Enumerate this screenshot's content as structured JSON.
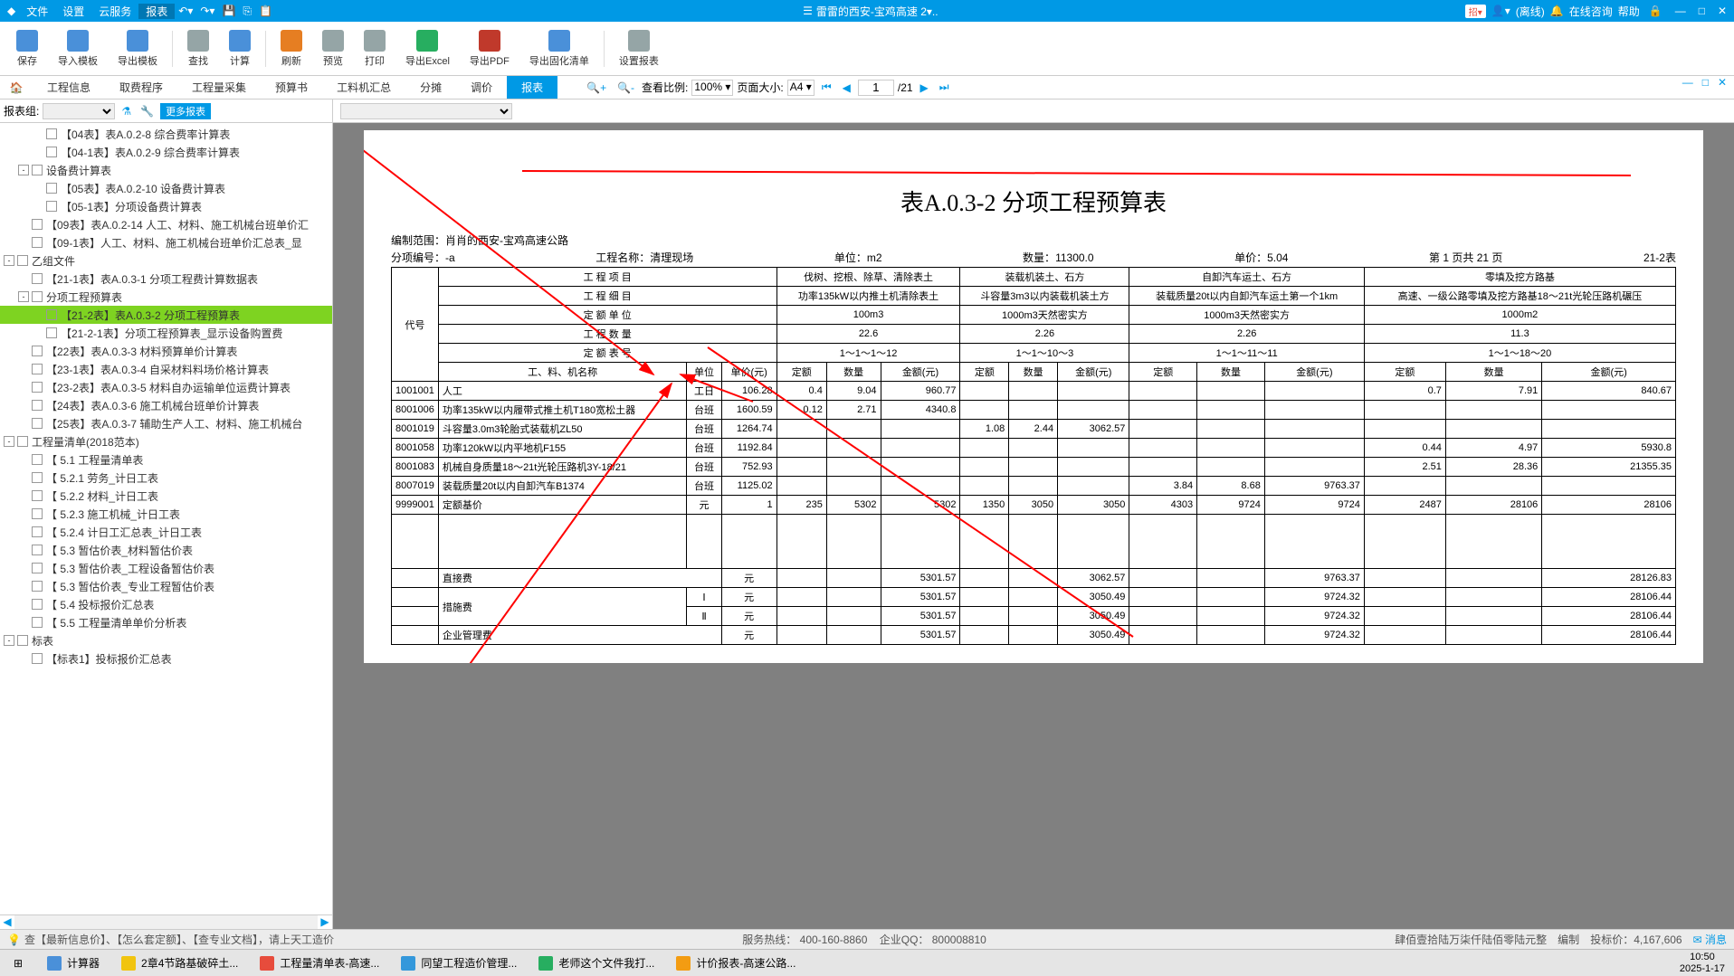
{
  "titleBar": {
    "menus": [
      "文件",
      "设置",
      "云服务",
      "报表"
    ],
    "docTitle": "雷雷的西安-宝鸡高速 2▾..",
    "badge": "招▾",
    "status": "(离线)",
    "consult": "在线咨询",
    "help": "帮助"
  },
  "ribbon": {
    "items": [
      "保存",
      "导入模板",
      "导出模板",
      "查找",
      "计算",
      "刷新",
      "预览",
      "打印",
      "导出Excel",
      "导出PDF",
      "导出固化清单",
      "设置报表"
    ]
  },
  "secTabs": {
    "tabs": [
      "工程信息",
      "取费程序",
      "工程量采集",
      "预算书",
      "工料机汇总",
      "分摊",
      "调价",
      "报表"
    ],
    "active": 7,
    "zoomLabel": "查看比例:",
    "zoomVal": "100% ▾",
    "pageSizeLabel": "页面大小:",
    "pageSizeVal": "A4 ▾",
    "pageInput": "1",
    "pageTotal": "/21"
  },
  "sidebar": {
    "groupLabel": "报表组:",
    "moreBtn": "更多报表",
    "tree": [
      {
        "lvl": 2,
        "exp": "",
        "label": "【04表】表A.0.2-8 综合费率计算表"
      },
      {
        "lvl": 2,
        "exp": "",
        "label": "【04-1表】表A.0.2-9 综合费率计算表"
      },
      {
        "lvl": 1,
        "exp": "-",
        "label": "设备费计算表"
      },
      {
        "lvl": 2,
        "exp": "",
        "label": "【05表】表A.0.2-10 设备费计算表"
      },
      {
        "lvl": 2,
        "exp": "",
        "label": "【05-1表】分项设备费计算表"
      },
      {
        "lvl": 1,
        "exp": "",
        "label": "【09表】表A.0.2-14 人工、材料、施工机械台班单价汇"
      },
      {
        "lvl": 1,
        "exp": "",
        "label": "【09-1表】人工、材料、施工机械台班单价汇总表_显"
      },
      {
        "lvl": 0,
        "exp": "-",
        "label": "乙组文件"
      },
      {
        "lvl": 1,
        "exp": "",
        "label": "【21-1表】表A.0.3-1 分项工程费计算数据表"
      },
      {
        "lvl": 1,
        "exp": "-",
        "label": "分项工程预算表"
      },
      {
        "lvl": 2,
        "exp": "",
        "label": "【21-2表】表A.0.3-2 分项工程预算表",
        "selected": true
      },
      {
        "lvl": 2,
        "exp": "",
        "label": "【21-2-1表】分项工程预算表_显示设备购置费"
      },
      {
        "lvl": 1,
        "exp": "",
        "label": "【22表】表A.0.3-3 材料预算单价计算表"
      },
      {
        "lvl": 1,
        "exp": "",
        "label": "【23-1表】表A.0.3-4 自采材料料场价格计算表"
      },
      {
        "lvl": 1,
        "exp": "",
        "label": "【23-2表】表A.0.3-5 材料自办运输单位运费计算表"
      },
      {
        "lvl": 1,
        "exp": "",
        "label": "【24表】表A.0.3-6 施工机械台班单价计算表"
      },
      {
        "lvl": 1,
        "exp": "",
        "label": "【25表】表A.0.3-7 辅助生产人工、材料、施工机械台"
      },
      {
        "lvl": 0,
        "exp": "-",
        "label": "工程量清单(2018范本)"
      },
      {
        "lvl": 1,
        "exp": "",
        "label": "【 5.1 工程量清单表"
      },
      {
        "lvl": 1,
        "exp": "",
        "label": "【 5.2.1 劳务_计日工表"
      },
      {
        "lvl": 1,
        "exp": "",
        "label": "【 5.2.2 材料_计日工表"
      },
      {
        "lvl": 1,
        "exp": "",
        "label": "【 5.2.3 施工机械_计日工表"
      },
      {
        "lvl": 1,
        "exp": "",
        "label": "【 5.2.4 计日工汇总表_计日工表"
      },
      {
        "lvl": 1,
        "exp": "",
        "label": "【 5.3 暂估价表_材料暂估价表"
      },
      {
        "lvl": 1,
        "exp": "",
        "label": "【 5.3 暂估价表_工程设备暂估价表"
      },
      {
        "lvl": 1,
        "exp": "",
        "label": "【 5.3 暂估价表_专业工程暂估价表"
      },
      {
        "lvl": 1,
        "exp": "",
        "label": "【 5.4 投标报价汇总表"
      },
      {
        "lvl": 1,
        "exp": "",
        "label": "【 5.5 工程量清单单价分析表"
      },
      {
        "lvl": 0,
        "exp": "-",
        "label": "标表"
      },
      {
        "lvl": 1,
        "exp": "",
        "label": "【标表1】投标报价汇总表"
      }
    ]
  },
  "report": {
    "title": "表A.0.3-2  分项工程预算表",
    "meta": {
      "scopeLabel": "编制范围：",
      "scope": "肖肖的西安-宝鸡高速公路",
      "codeLabel": "分项编号：",
      "code": "-a",
      "nameLabel": "工程名称：",
      "name": "清理现场",
      "unitLabel": "单位：",
      "unit": "m2",
      "qtyLabel": "数量：",
      "qty": "11300.0",
      "priceLabel": "单价：",
      "price": "5.04",
      "pageLabel": "第 1 页共 21 页",
      "tableNo": "21-2表"
    },
    "headers": {
      "daihao": "代号",
      "gcxm": "工 程 项 目",
      "gcxd": "工 程 细 目",
      "dedw": "定 额 单 位",
      "gcsl": "工 程 数 量",
      "debh": "定 额 表 号",
      "gljmc": "工、料、机名称",
      "dw": "单位",
      "dj": "单价(元)",
      "de": "定额",
      "sl": "数量",
      "je": "金额(元)"
    },
    "projItems": [
      "伐树、挖根、除草、清除表土",
      "装载机装土、石方",
      "自卸汽车运土、石方",
      "零填及挖方路基"
    ],
    "details": [
      "功率135kW以内推土机清除表土",
      "斗容量3m3以内装载机装土方",
      "装载质量20t以内自卸汽车运土第一个1km",
      "高速、一级公路零填及挖方路基18～21t光轮压路机碾压"
    ],
    "units": [
      "100m3",
      "1000m3天然密实方",
      "1000m3天然密实方",
      "1000m2"
    ],
    "qtys": [
      "22.6",
      "2.26",
      "2.26",
      "11.3"
    ],
    "tabNos": [
      "1～1～1～12",
      "1～1～10～3",
      "1～1～11～11",
      "1～1～18～20"
    ],
    "rows": [
      {
        "code": "1001001",
        "name": "人工",
        "unit": "工日",
        "price": "106.28",
        "c": [
          [
            "0.4",
            "9.04",
            "960.77"
          ],
          [
            "",
            "",
            ""
          ],
          [
            "",
            "",
            ""
          ],
          [
            "0.7",
            "7.91",
            "840.67"
          ]
        ]
      },
      {
        "code": "8001006",
        "name": "功率135kW以内履带式推土机T180宽松土器",
        "unit": "台班",
        "price": "1600.59",
        "c": [
          [
            "0.12",
            "2.71",
            "4340.8"
          ],
          [
            "",
            "",
            ""
          ],
          [
            "",
            "",
            ""
          ],
          [
            "",
            "",
            ""
          ]
        ]
      },
      {
        "code": "8001019",
        "name": "斗容量3.0m3轮胎式装载机ZL50",
        "unit": "台班",
        "price": "1264.74",
        "c": [
          [
            "",
            "",
            ""
          ],
          [
            "1.08",
            "2.44",
            "3062.57"
          ],
          [
            "",
            "",
            ""
          ],
          [
            "",
            "",
            ""
          ]
        ]
      },
      {
        "code": "8001058",
        "name": "功率120kW以内平地机F155",
        "unit": "台班",
        "price": "1192.84",
        "c": [
          [
            "",
            "",
            ""
          ],
          [
            "",
            "",
            ""
          ],
          [
            "",
            "",
            ""
          ],
          [
            "0.44",
            "4.97",
            "5930.8"
          ]
        ]
      },
      {
        "code": "8001083",
        "name": "机械自身质量18～21t光轮压路机3Y-18/21",
        "unit": "台班",
        "price": "752.93",
        "c": [
          [
            "",
            "",
            ""
          ],
          [
            "",
            "",
            ""
          ],
          [
            "",
            "",
            ""
          ],
          [
            "2.51",
            "28.36",
            "21355.35"
          ]
        ]
      },
      {
        "code": "8007019",
        "name": "装载质量20t以内自卸汽车B1374",
        "unit": "台班",
        "price": "1125.02",
        "c": [
          [
            "",
            "",
            ""
          ],
          [
            "",
            "",
            ""
          ],
          [
            "3.84",
            "8.68",
            "9763.37"
          ],
          [
            "",
            "",
            ""
          ]
        ]
      },
      {
        "code": "9999001",
        "name": "定额基价",
        "unit": "元",
        "price": "1",
        "c": [
          [
            "235",
            "5302",
            "5302"
          ],
          [
            "1350",
            "3050",
            "3050"
          ],
          [
            "4303",
            "9724",
            "9724"
          ],
          [
            "2487",
            "28106",
            "28106"
          ]
        ]
      }
    ],
    "subtotals": {
      "direct": {
        "label": "直接费",
        "unit": "元",
        "v": [
          "5301.57",
          "",
          "3062.57",
          "",
          "9763.37",
          "",
          "28126.83"
        ]
      },
      "cuoshi": {
        "label": "措施费",
        "rows": [
          {
            "n": "Ⅰ",
            "unit": "元",
            "v": [
              "5301.57",
              "",
              "3050.49",
              "",
              "9724.32",
              "",
              "28106.44"
            ]
          },
          {
            "n": "Ⅱ",
            "unit": "元",
            "v": [
              "5301.57",
              "",
              "3050.49",
              "",
              "9724.32",
              "",
              "28106.44"
            ]
          }
        ]
      },
      "mgmt": {
        "label": "企业管理费",
        "unit": "元",
        "v": [
          "5301.57",
          "",
          "3050.49",
          "",
          "9724.32",
          "",
          "28106.44"
        ]
      }
    }
  },
  "statusBar": {
    "tip": "查【最新信息价】、【怎么套定额】、【查专业文档】，请上天工造价",
    "hotlineLabel": "服务热线：",
    "hotline": "400-160-8860",
    "qqLabel": "企业QQ：",
    "qq": "800008810",
    "amountCn": "肆佰壹拾陆万柒仟陆佰零陆元整",
    "editLabel": "编制",
    "bidLabel": "投标价：",
    "bidVal": "4,167,606",
    "msgLink": "消息"
  },
  "taskbar": {
    "items": [
      "计算器",
      "2章4节路基破碎土...",
      "工程量清单表-高速...",
      "同望工程造价管理...",
      "老师这个文件我打...",
      "计价报表-高速公路..."
    ],
    "time": "10:50",
    "date": "2025-1-17"
  }
}
